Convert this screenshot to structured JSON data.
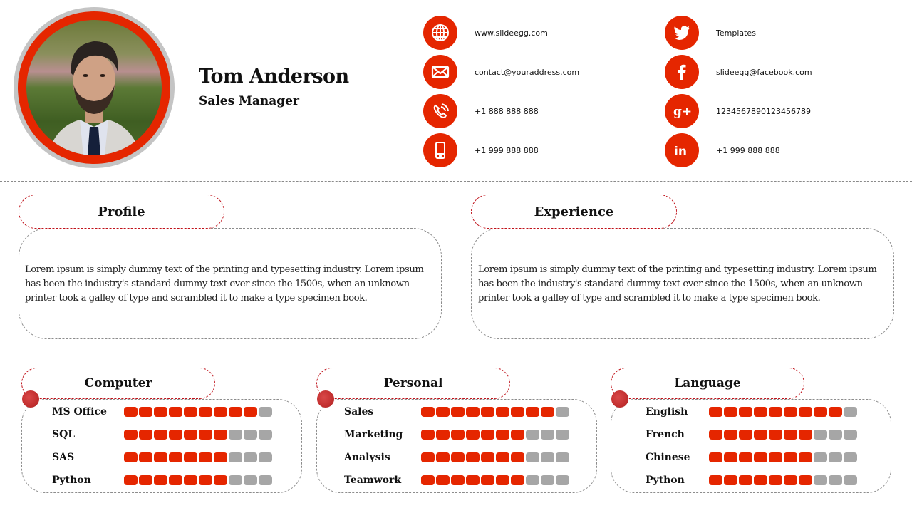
{
  "header": {
    "name": "Tom Anderson",
    "title": "Sales Manager"
  },
  "contacts_left": [
    {
      "icon": "globe-icon",
      "text": "www.slideegg.com"
    },
    {
      "icon": "envelope-icon",
      "text": "contact@youraddress.com"
    },
    {
      "icon": "phone-icon",
      "text": "+1 888 888 888"
    },
    {
      "icon": "mobile-icon",
      "text": "+1 999 888 888"
    }
  ],
  "contacts_right": [
    {
      "icon": "twitter-icon",
      "text": "Templates"
    },
    {
      "icon": "facebook-icon",
      "text": "slideegg@facebook.com"
    },
    {
      "icon": "google-plus-icon",
      "text": "1234567890123456789"
    },
    {
      "icon": "linkedin-icon",
      "text": "+1 999 888 888"
    }
  ],
  "profile": {
    "heading": "Profile",
    "text": "Lorem ipsum is simply dummy text of the printing and typesetting industry. Lorem ipsum has been the industry's standard dummy text ever since the 1500s, when an unknown printer took a galley of type and scrambled it to make a type specimen book."
  },
  "experience": {
    "heading": "Experience",
    "text": "Lorem ipsum is simply dummy text of the printing and typesetting industry. Lorem ipsum has been the industry's standard dummy text ever since the 1500s, when an unknown printer took a galley of type and scrambled it to make a type specimen book."
  },
  "skills": [
    {
      "heading": "Computer",
      "items": [
        {
          "label": "MS Office",
          "level": 9,
          "max": 10
        },
        {
          "label": "SQL",
          "level": 7,
          "max": 10
        },
        {
          "label": "SAS",
          "level": 7,
          "max": 10
        },
        {
          "label": "Python",
          "level": 7,
          "max": 10
        }
      ]
    },
    {
      "heading": "Personal",
      "items": [
        {
          "label": "Sales",
          "level": 9,
          "max": 10
        },
        {
          "label": "Marketing",
          "level": 7,
          "max": 10
        },
        {
          "label": "Analysis",
          "level": 7,
          "max": 10
        },
        {
          "label": "Teamwork",
          "level": 7,
          "max": 10
        }
      ]
    },
    {
      "heading": "Language",
      "items": [
        {
          "label": "English",
          "level": 9,
          "max": 10
        },
        {
          "label": "French",
          "level": 7,
          "max": 10
        },
        {
          "label": "Chinese",
          "level": 7,
          "max": 10
        },
        {
          "label": "Python",
          "level": 7,
          "max": 10
        }
      ]
    }
  ],
  "colors": {
    "accent": "#e52600",
    "inactive": "#a6a6a6",
    "ring": "#c4c4c4"
  }
}
